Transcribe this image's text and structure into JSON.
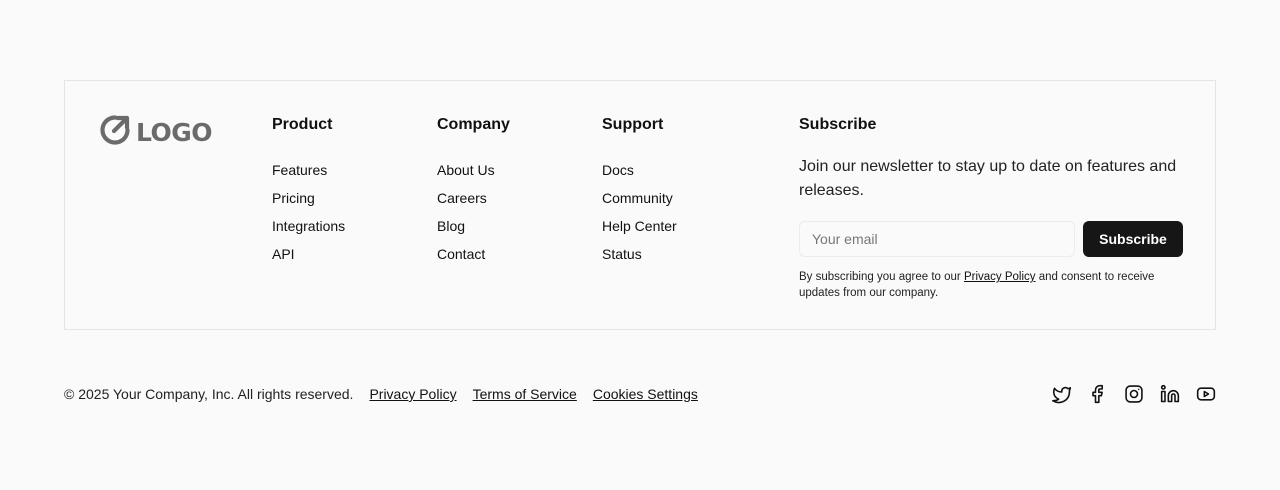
{
  "logo": {
    "text": "LOGO",
    "icon": "logo-arrow-circle-icon"
  },
  "columns": [
    {
      "title": "Product",
      "links": [
        "Features",
        "Pricing",
        "Integrations",
        "API"
      ]
    },
    {
      "title": "Company",
      "links": [
        "About Us",
        "Careers",
        "Blog",
        "Contact"
      ]
    },
    {
      "title": "Support",
      "links": [
        "Docs",
        "Community",
        "Help Center",
        "Status"
      ]
    }
  ],
  "subscribe": {
    "title": "Subscribe",
    "description": "Join our newsletter to stay up to date on features and releases.",
    "email_placeholder": "Your email",
    "button_label": "Subscribe",
    "consent_prefix": "By subscribing you agree to our ",
    "consent_link": "Privacy Policy",
    "consent_suffix": " and consent to receive updates from our company."
  },
  "bottom": {
    "copyright": "© 2025 Your Company, Inc. All rights reserved.",
    "links": [
      "Privacy Policy",
      "Terms of Service",
      "Cookies Settings"
    ]
  },
  "socials": [
    "twitter-icon",
    "facebook-icon",
    "instagram-icon",
    "linkedin-icon",
    "youtube-icon"
  ],
  "colors": {
    "background": "#fafafa",
    "border": "#e4e4e4",
    "button": "#161616",
    "logo": "#6b6b6b"
  }
}
